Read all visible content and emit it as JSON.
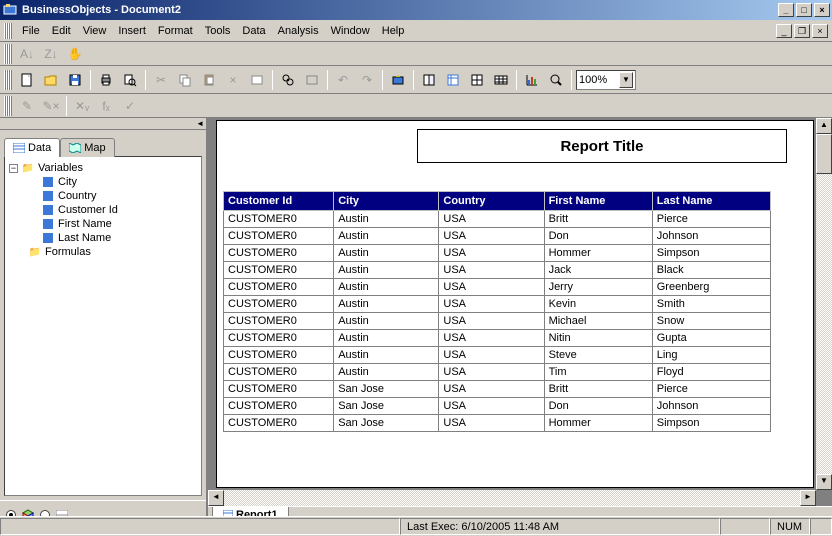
{
  "window": {
    "title": "BusinessObjects - Document2"
  },
  "menu": {
    "items": [
      "File",
      "Edit",
      "View",
      "Insert",
      "Format",
      "Tools",
      "Data",
      "Analysis",
      "Window",
      "Help"
    ]
  },
  "zoom": {
    "value": "100%"
  },
  "sidebar": {
    "tabs": {
      "data": "Data",
      "map": "Map"
    },
    "variables_label": "Variables",
    "formulas_label": "Formulas",
    "variables": [
      "City",
      "Country",
      "Customer Id",
      "First Name",
      "Last Name"
    ]
  },
  "report": {
    "title": "Report Title",
    "tab": "Report1",
    "columns": [
      "Customer Id",
      "City",
      "Country",
      "First Name",
      "Last Name"
    ],
    "rows": [
      [
        "CUSTOMER0",
        "Austin",
        "USA",
        "Britt",
        "Pierce"
      ],
      [
        "CUSTOMER0",
        "Austin",
        "USA",
        "Don",
        "Johnson"
      ],
      [
        "CUSTOMER0",
        "Austin",
        "USA",
        "Hommer",
        "Simpson"
      ],
      [
        "CUSTOMER0",
        "Austin",
        "USA",
        "Jack",
        "Black"
      ],
      [
        "CUSTOMER0",
        "Austin",
        "USA",
        "Jerry",
        "Greenberg"
      ],
      [
        "CUSTOMER0",
        "Austin",
        "USA",
        "Kevin",
        "Smith"
      ],
      [
        "CUSTOMER0",
        "Austin",
        "USA",
        "Michael",
        "Snow"
      ],
      [
        "CUSTOMER0",
        "Austin",
        "USA",
        "Nitin",
        "Gupta"
      ],
      [
        "CUSTOMER0",
        "Austin",
        "USA",
        "Steve",
        "Ling"
      ],
      [
        "CUSTOMER0",
        "Austin",
        "USA",
        "Tim",
        "Floyd"
      ],
      [
        "CUSTOMER0",
        "San Jose",
        "USA",
        "Britt",
        "Pierce"
      ],
      [
        "CUSTOMER0",
        "San Jose",
        "USA",
        "Don",
        "Johnson"
      ],
      [
        "CUSTOMER0",
        "San Jose",
        "USA",
        "Hommer",
        "Simpson"
      ]
    ]
  },
  "status": {
    "last_exec": "Last Exec: 6/10/2005  11:48 AM",
    "num": "NUM"
  }
}
